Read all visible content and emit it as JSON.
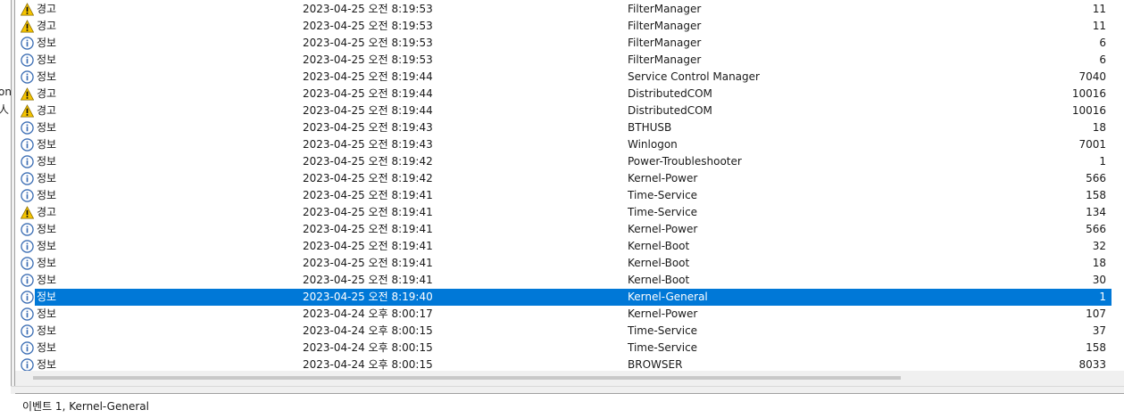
{
  "left_fragments": [
    "on",
    "人"
  ],
  "levels": {
    "warning": "경고",
    "info": "정보"
  },
  "rows": [
    {
      "level": "경고",
      "type": "warning",
      "date": "2023-04-25 오전 8:19:53",
      "source": "FilterManager",
      "id": "11"
    },
    {
      "level": "경고",
      "type": "warning",
      "date": "2023-04-25 오전 8:19:53",
      "source": "FilterManager",
      "id": "11"
    },
    {
      "level": "정보",
      "type": "info",
      "date": "2023-04-25 오전 8:19:53",
      "source": "FilterManager",
      "id": "6"
    },
    {
      "level": "정보",
      "type": "info",
      "date": "2023-04-25 오전 8:19:53",
      "source": "FilterManager",
      "id": "6"
    },
    {
      "level": "정보",
      "type": "info",
      "date": "2023-04-25 오전 8:19:44",
      "source": "Service Control Manager",
      "id": "7040"
    },
    {
      "level": "경고",
      "type": "warning",
      "date": "2023-04-25 오전 8:19:44",
      "source": "DistributedCOM",
      "id": "10016"
    },
    {
      "level": "경고",
      "type": "warning",
      "date": "2023-04-25 오전 8:19:44",
      "source": "DistributedCOM",
      "id": "10016"
    },
    {
      "level": "정보",
      "type": "info",
      "date": "2023-04-25 오전 8:19:43",
      "source": "BTHUSB",
      "id": "18"
    },
    {
      "level": "정보",
      "type": "info",
      "date": "2023-04-25 오전 8:19:43",
      "source": "Winlogon",
      "id": "7001"
    },
    {
      "level": "정보",
      "type": "info",
      "date": "2023-04-25 오전 8:19:42",
      "source": "Power-Troubleshooter",
      "id": "1"
    },
    {
      "level": "정보",
      "type": "info",
      "date": "2023-04-25 오전 8:19:42",
      "source": "Kernel-Power",
      "id": "566"
    },
    {
      "level": "정보",
      "type": "info",
      "date": "2023-04-25 오전 8:19:41",
      "source": "Time-Service",
      "id": "158"
    },
    {
      "level": "경고",
      "type": "warning",
      "date": "2023-04-25 오전 8:19:41",
      "source": "Time-Service",
      "id": "134"
    },
    {
      "level": "정보",
      "type": "info",
      "date": "2023-04-25 오전 8:19:41",
      "source": "Kernel-Power",
      "id": "566"
    },
    {
      "level": "정보",
      "type": "info",
      "date": "2023-04-25 오전 8:19:41",
      "source": "Kernel-Boot",
      "id": "32"
    },
    {
      "level": "정보",
      "type": "info",
      "date": "2023-04-25 오전 8:19:41",
      "source": "Kernel-Boot",
      "id": "18"
    },
    {
      "level": "정보",
      "type": "info",
      "date": "2023-04-25 오전 8:19:41",
      "source": "Kernel-Boot",
      "id": "30"
    },
    {
      "level": "정보",
      "type": "info",
      "date": "2023-04-25 오전 8:19:40",
      "source": "Kernel-General",
      "id": "1",
      "selected": true
    },
    {
      "level": "정보",
      "type": "info",
      "date": "2023-04-24 오후 8:00:17",
      "source": "Kernel-Power",
      "id": "107"
    },
    {
      "level": "정보",
      "type": "info",
      "date": "2023-04-24 오후 8:00:15",
      "source": "Time-Service",
      "id": "37"
    },
    {
      "level": "정보",
      "type": "info",
      "date": "2023-04-24 오후 8:00:15",
      "source": "Time-Service",
      "id": "158"
    },
    {
      "level": "정보",
      "type": "info",
      "date": "2023-04-24 오후 8:00:15",
      "source": "BROWSER",
      "id": "8033"
    }
  ],
  "status": {
    "text": "이벤트 1, Kernel-General"
  },
  "colors": {
    "selection": "#0078d7",
    "info_icon": "#3c6eb4",
    "warning_icon": "#f5c400"
  }
}
